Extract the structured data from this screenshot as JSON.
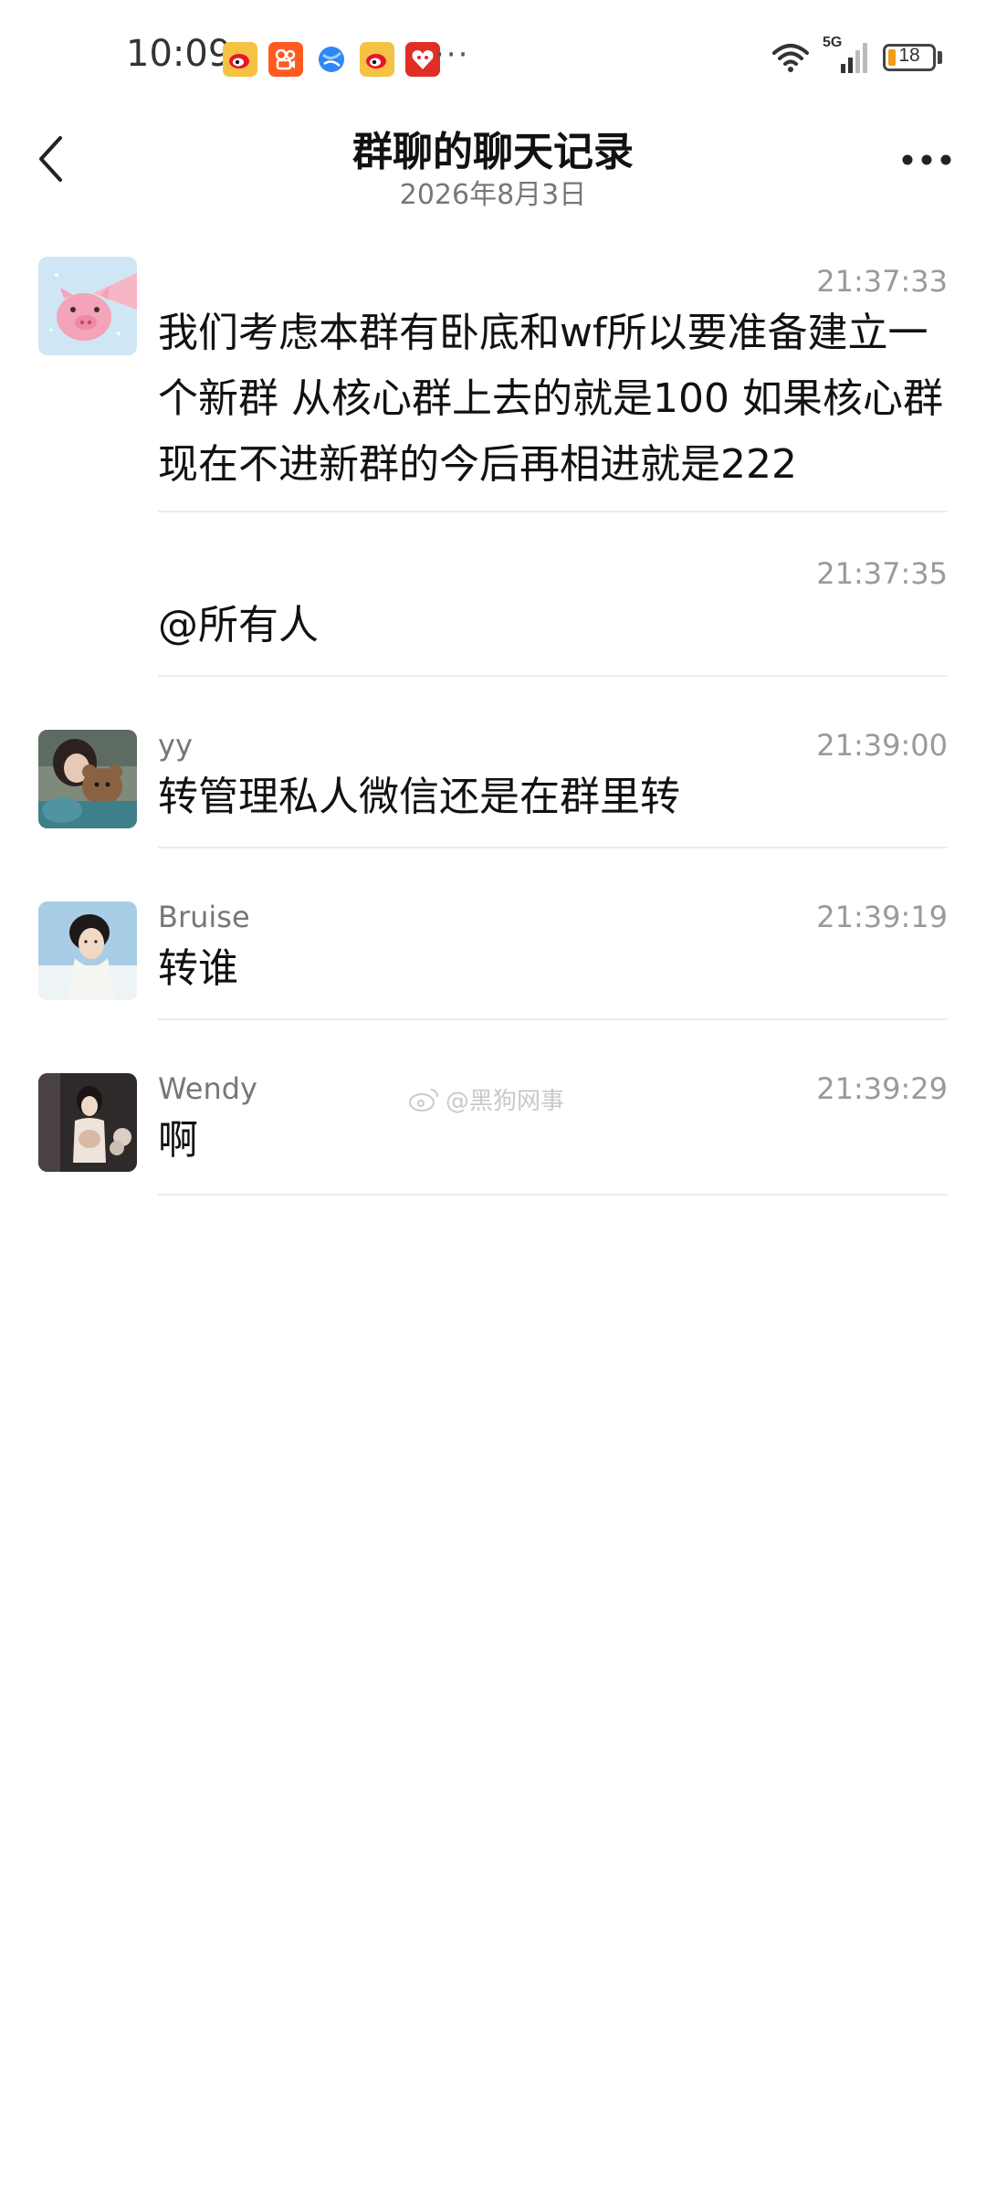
{
  "status_bar": {
    "time": "10:09",
    "apps": [
      {
        "name": "weibo-app-icon",
        "color": "#f5c243"
      },
      {
        "name": "kuaishou-app-icon",
        "color": "#ff5a1f"
      },
      {
        "name": "browser-app-icon",
        "color": "#2f86f6"
      },
      {
        "name": "weibo-app-icon-2",
        "color": "#f5c243"
      },
      {
        "name": "pinduoduo-app-icon",
        "color": "#e02e24"
      }
    ],
    "more": "···",
    "network": "5G",
    "battery": "18",
    "battery_color": "#f39c12"
  },
  "header": {
    "title": "群聊的聊天记录",
    "subtitle": "2026年8月3日"
  },
  "messages": [
    {
      "sender": "",
      "time": "21:37:33",
      "text": "我们考虑本群有卧底和wf所以要准备建立一个新群 从核心群上去的就是100 如果核心群现在不进新群的今后再相进就是222",
      "avatar": "pig-cartoon"
    },
    {
      "sender": "",
      "time": "21:37:35",
      "text": "@所有人"
    },
    {
      "sender": "yy",
      "time": "21:39:00",
      "text": "转管理私人微信还是在群里转",
      "avatar": "girl-with-bear-photo"
    },
    {
      "sender": "Bruise",
      "time": "21:39:19",
      "text": "转谁",
      "avatar": "woman-portrait-photo"
    },
    {
      "sender": "Wendy",
      "time": "21:39:29",
      "text": "啊",
      "avatar": "woman-dark-photo"
    }
  ],
  "watermark": {
    "text": "@黑狗网事"
  }
}
